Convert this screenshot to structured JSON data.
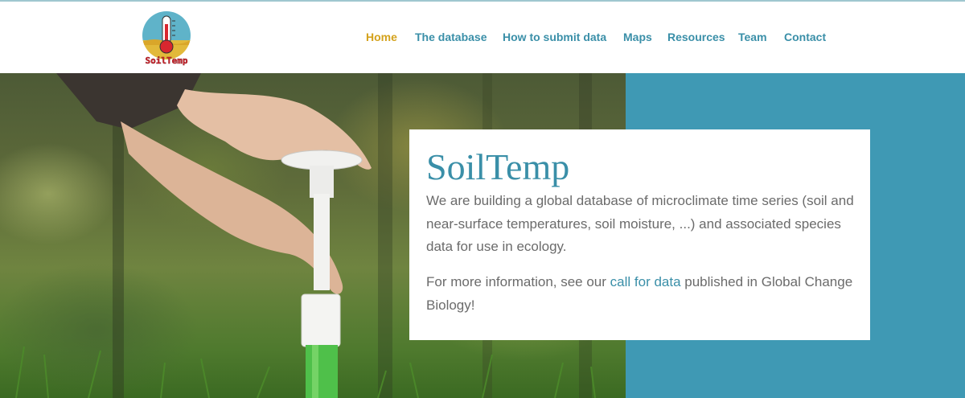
{
  "site": {
    "logo_text": "SoilTemp",
    "logo_icon": "thermometer-icon"
  },
  "nav": {
    "items": [
      {
        "label": "Home",
        "active": true
      },
      {
        "label": "The database",
        "active": false
      },
      {
        "label": "How to submit data",
        "active": false
      },
      {
        "label": "Maps",
        "active": false
      },
      {
        "label": "Resources",
        "active": false
      },
      {
        "label": "Team",
        "active": false
      },
      {
        "label": "Contact",
        "active": false
      }
    ]
  },
  "hero": {
    "title": "SoilTemp",
    "description": "We are building a global database of microclimate time series (soil and near-surface temperatures, soil moisture, ...) and associated species data for use in ecology.",
    "info_prefix": "For more information, see our ",
    "info_link": "call for data",
    "info_suffix": " published in Global Change Biology!"
  },
  "colors": {
    "accent": "#3a8fa8",
    "active_nav": "#d4a21c",
    "hero_background": "#3f99b4",
    "body_text": "#6b6b6b"
  }
}
